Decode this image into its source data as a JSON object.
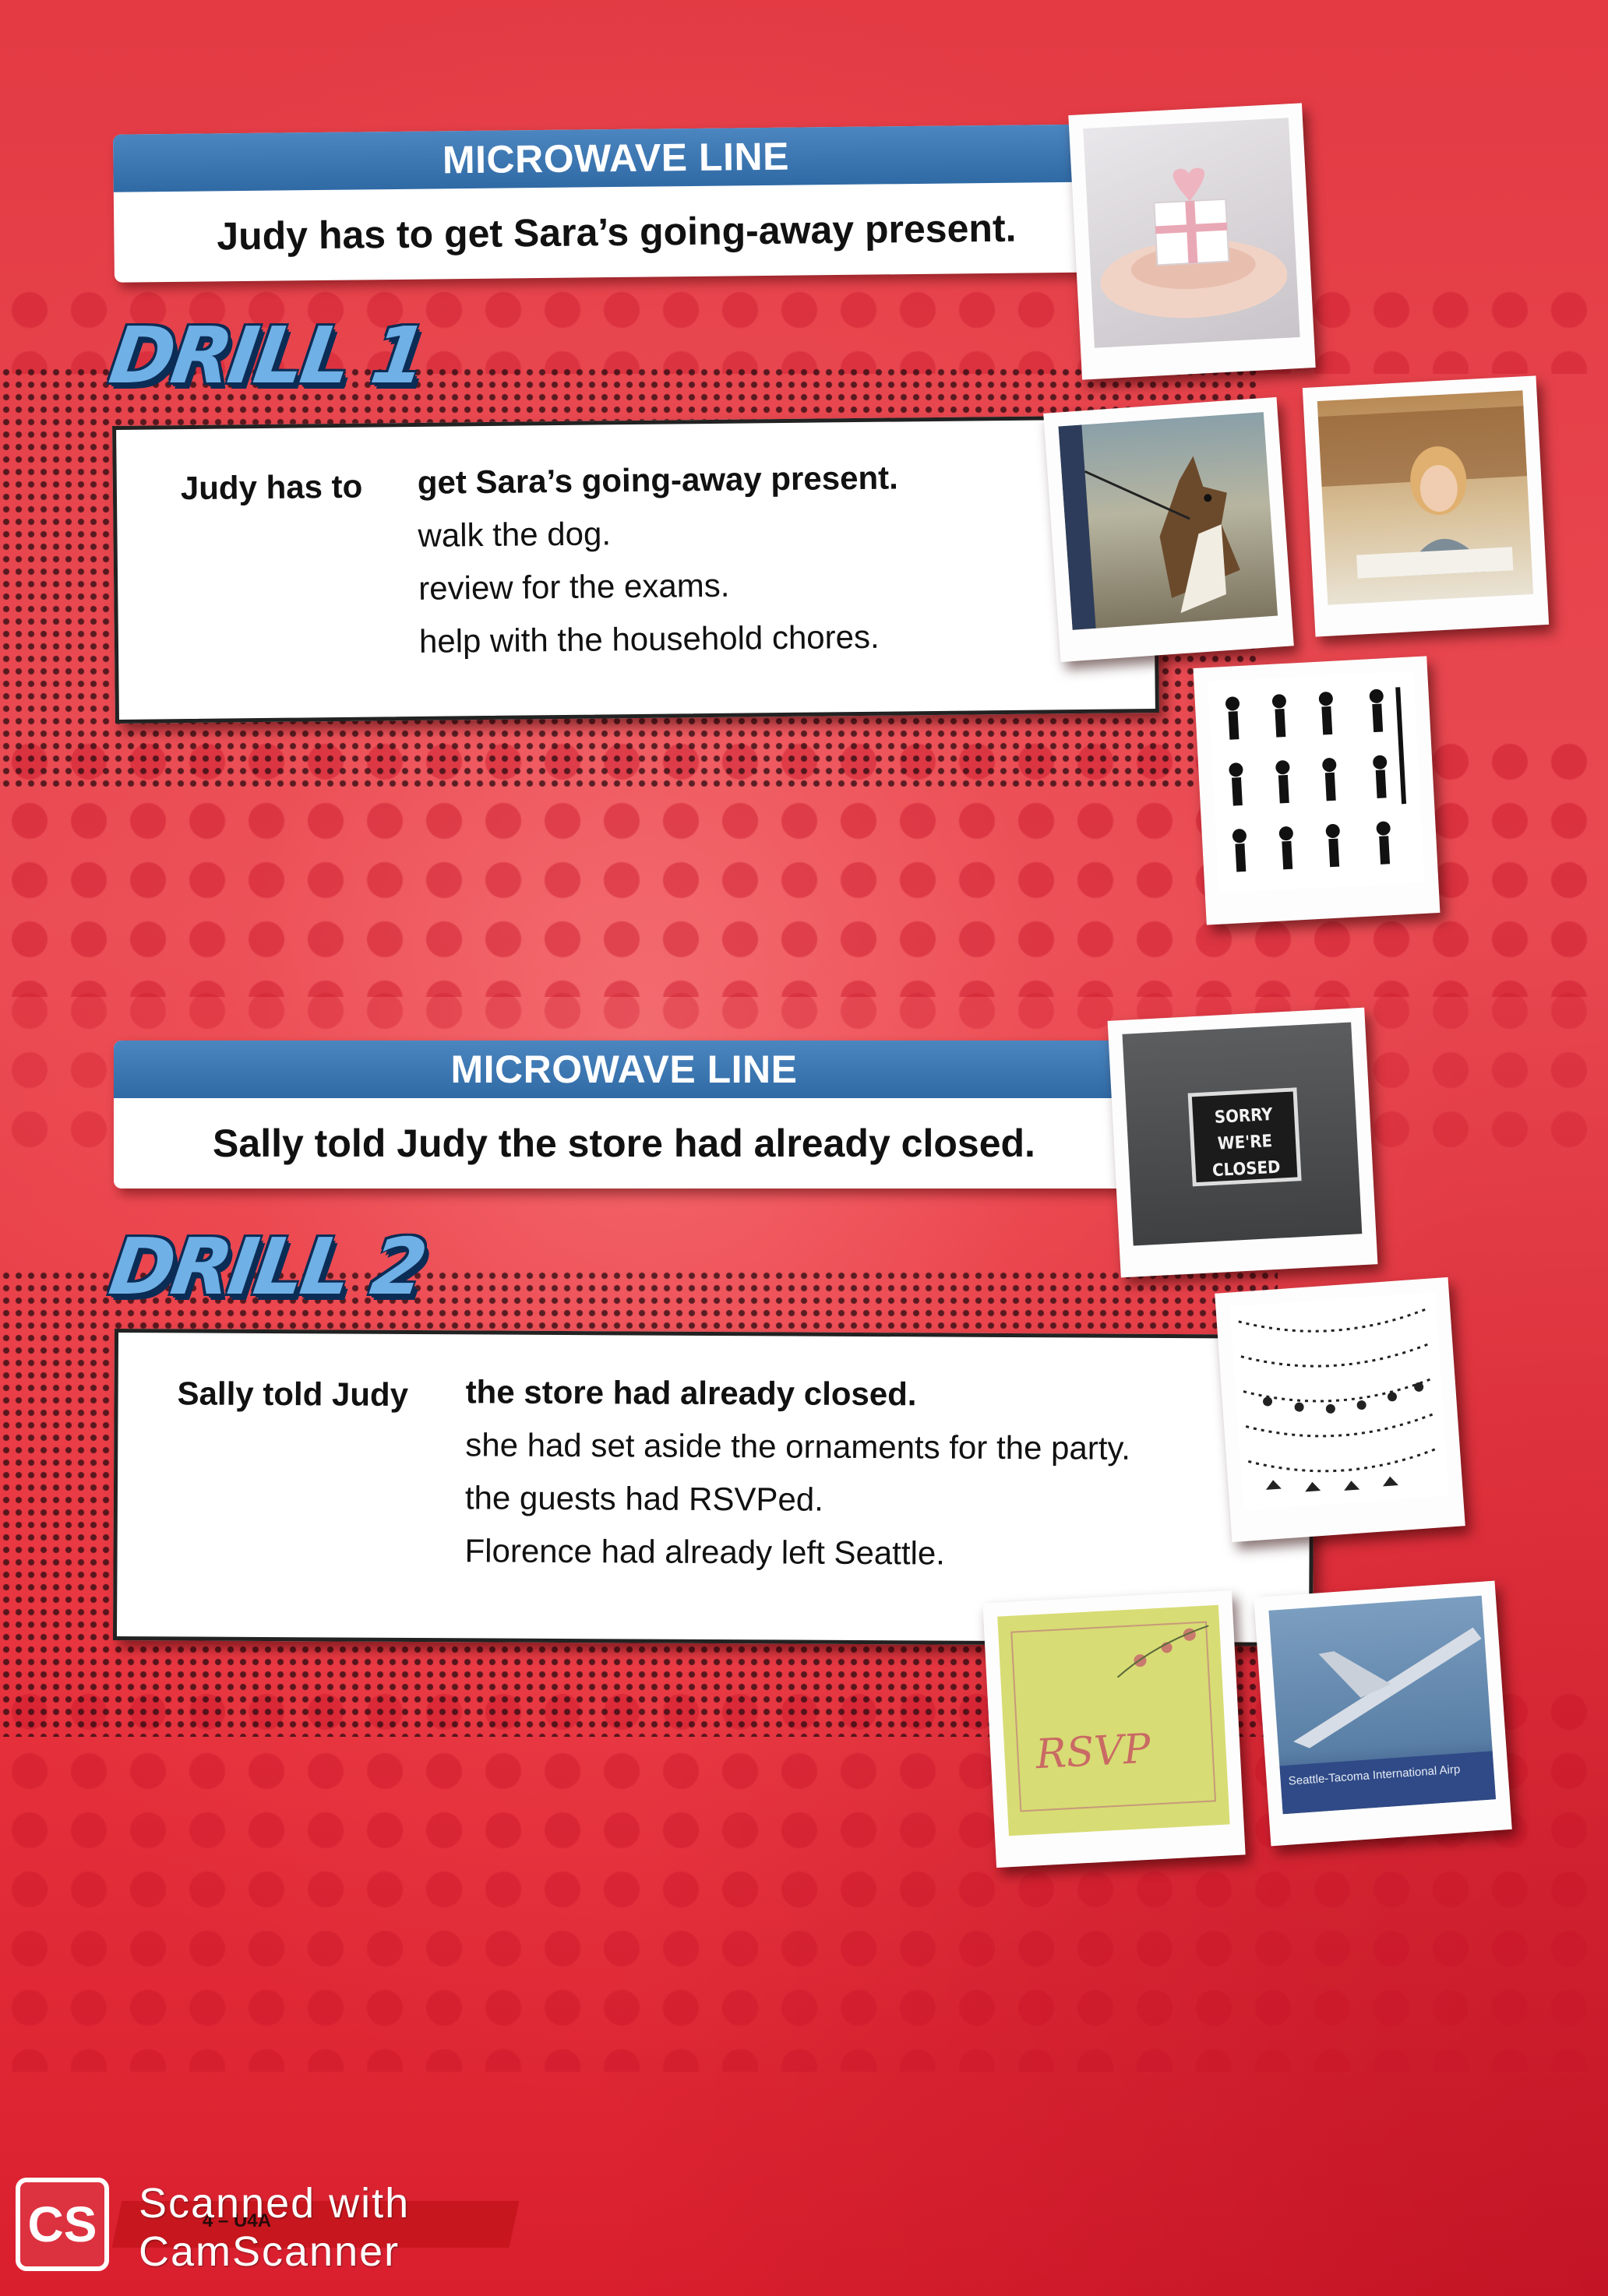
{
  "section1": {
    "microwave_title": "MICROWAVE LINE",
    "microwave_line": "Judy has to get Sara’s going-away present.",
    "drill_title": "DRILL 1",
    "lead": "Judy has to",
    "options": [
      "get Sara’s going-away present.",
      "walk the dog.",
      "review for the exams.",
      "help with the household chores."
    ]
  },
  "section2": {
    "microwave_title": "MICROWAVE LINE",
    "microwave_line": "Sally told Judy the store had already closed.",
    "drill_title": "DRILL 2",
    "lead": "Sally told Judy",
    "options": [
      "the store had already closed.",
      "she had set aside the ornaments for the party.",
      "the guests had RSVPed.",
      "Florence had already left Seattle."
    ]
  },
  "photos": {
    "closed_sign": "SORRY WE'RE CLOSED",
    "rsvp": "RSVP",
    "airport": "Seattle-Tacoma International Airp"
  },
  "footer": {
    "scanner_badge": "CS",
    "scanner_line1": "Scanned with",
    "scanner_line2": "CamScanner",
    "page_ref": "4 – U4A"
  },
  "colors": {
    "background": "#e8343f",
    "microwave_header": "#2f6aa5",
    "drill_label": "#6fb0e6"
  }
}
